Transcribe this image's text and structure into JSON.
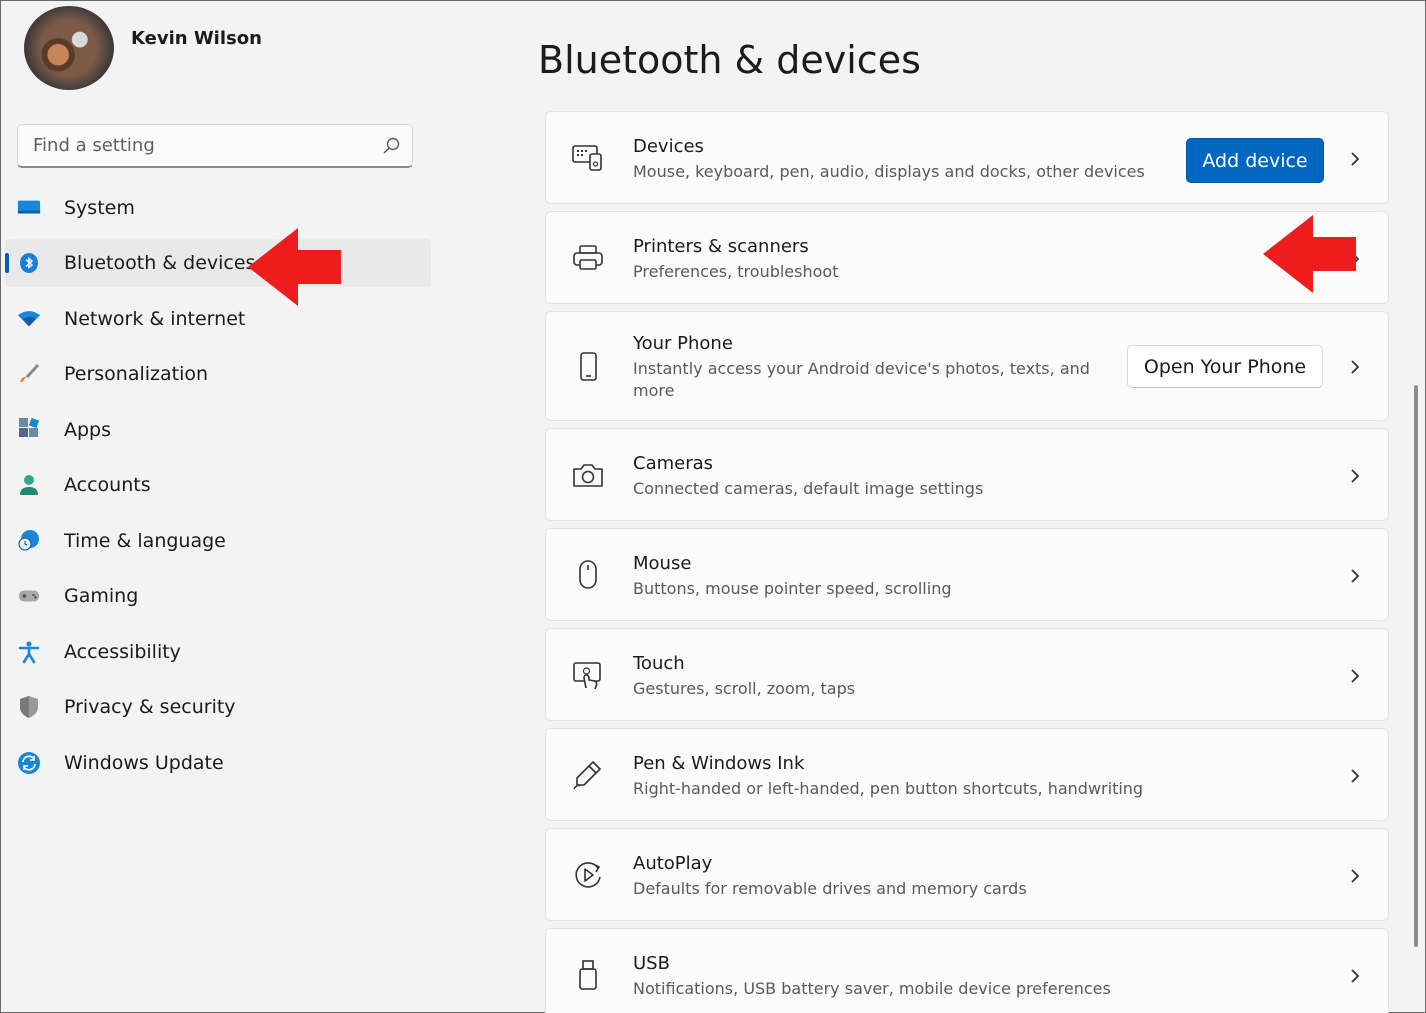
{
  "user": {
    "name": "Kevin Wilson"
  },
  "search": {
    "placeholder": "Find a setting"
  },
  "sidebar": {
    "items": [
      {
        "label": "System",
        "icon": "monitor-icon"
      },
      {
        "label": "Bluetooth & devices",
        "icon": "bluetooth-icon",
        "selected": true
      },
      {
        "label": "Network & internet",
        "icon": "wifi-icon"
      },
      {
        "label": "Personalization",
        "icon": "brush-icon"
      },
      {
        "label": "Apps",
        "icon": "apps-icon"
      },
      {
        "label": "Accounts",
        "icon": "person-icon"
      },
      {
        "label": "Time & language",
        "icon": "globe-clock-icon"
      },
      {
        "label": "Gaming",
        "icon": "gamepad-icon"
      },
      {
        "label": "Accessibility",
        "icon": "accessibility-icon"
      },
      {
        "label": "Privacy & security",
        "icon": "shield-icon"
      },
      {
        "label": "Windows Update",
        "icon": "sync-icon"
      }
    ]
  },
  "main": {
    "title": "Bluetooth & devices",
    "cards": [
      {
        "title": "Devices",
        "subtitle": "Mouse, keyboard, pen, audio, displays and docks, other devices",
        "icon": "devices-icon",
        "button": "Add device"
      },
      {
        "title": "Printers & scanners",
        "subtitle": "Preferences, troubleshoot",
        "icon": "printer-icon"
      },
      {
        "title": "Your Phone",
        "subtitle": "Instantly access your Android device's photos, texts, and more",
        "icon": "phone-icon",
        "button": "Open Your Phone"
      },
      {
        "title": "Cameras",
        "subtitle": "Connected cameras, default image settings",
        "icon": "camera-icon"
      },
      {
        "title": "Mouse",
        "subtitle": "Buttons, mouse pointer speed, scrolling",
        "icon": "mouse-icon"
      },
      {
        "title": "Touch",
        "subtitle": "Gestures, scroll, zoom, taps",
        "icon": "touch-icon"
      },
      {
        "title": "Pen & Windows Ink",
        "subtitle": "Right-handed or left-handed, pen button shortcuts, handwriting",
        "icon": "pen-icon"
      },
      {
        "title": "AutoPlay",
        "subtitle": "Defaults for removable drives and memory cards",
        "icon": "autoplay-icon"
      },
      {
        "title": "USB",
        "subtitle": "Notifications, USB battery saver, mobile device preferences",
        "icon": "usb-icon"
      }
    ]
  },
  "colors": {
    "accent": "#0067c0",
    "annotation_arrow": "#ee1c1c",
    "selected_bg": "#e9e9e9"
  }
}
